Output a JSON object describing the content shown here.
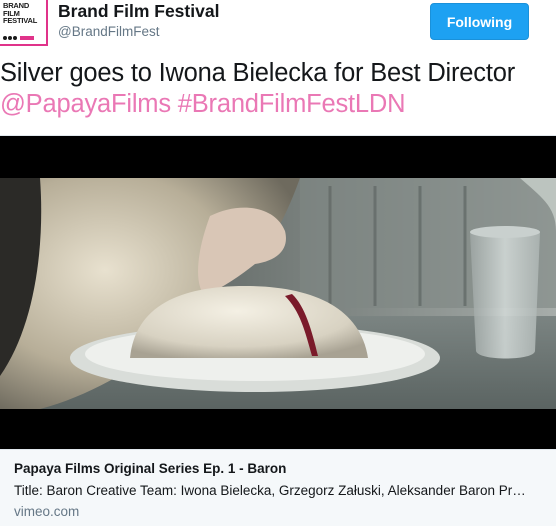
{
  "account": {
    "name": "Brand Film Festival",
    "handle": "@BrandFilmFest",
    "avatar_lines": [
      "BRAND",
      "FILM",
      "FESTIVAL"
    ]
  },
  "follow_button": {
    "label": "Following"
  },
  "tweet": {
    "text": "Silver goes to Iwona Bielecka for Best Director",
    "mention": "@PapayaFilms",
    "hashtag": "#BrandFilmFestLDN"
  },
  "card": {
    "title": "Papaya Films Original Series Ep. 1 - Baron",
    "description": "Title: Baron Creative Team: Iwona Bielecka, Grzegorz Załuski, Aleksander Baron Pr…",
    "domain": "vimeo.com"
  },
  "colors": {
    "brand_pink": "#e0338a",
    "link_pink": "#ea78b5",
    "follow_blue": "#1da1f2"
  }
}
